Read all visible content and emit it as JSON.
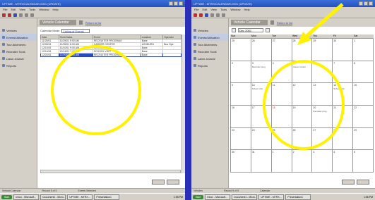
{
  "panels": [
    {
      "window_title": "UPTIME - MTRX/CALENDAR-0001 (UPDATE)",
      "menu": [
        "File",
        "Edit",
        "View",
        "Tools",
        "Window",
        "Help"
      ],
      "sidebar": [
        {
          "label": "Vehicles",
          "selected": false
        },
        {
          "label": "Events/Utilization",
          "selected": true
        },
        {
          "label": "Tour Allotments",
          "selected": false
        },
        {
          "label": "Recruiter Tools",
          "selected": false
        },
        {
          "label": "Labor Journal",
          "selected": false
        },
        {
          "label": "Reports",
          "selected": false
        }
      ],
      "page_title": "Vehicle Calendar",
      "header_link": "Return to list",
      "filter_label": "Calendar Mode",
      "filter_value": "Listing of Events",
      "table": {
        "columns": [
          "Date",
          "Time/Dates",
          "Event",
          "Location",
          "Operator"
        ],
        "rows": [
          [
            "11/29/01",
            "11/29/01 9:00 AM",
            "RECRUITER PROGRAM",
            "Base",
            ""
          ],
          [
            "12/05/01",
            "12/05/01 8:00 AM",
            "CAREER CENTER",
            "ASHBURN",
            "Bus Ops"
          ],
          [
            "12/10/01",
            "12/10/01 9:00 AM",
            "SCHOOL VISIT",
            "Base",
            ""
          ],
          [
            "12/14/01",
            "12/14/01 7:00 AM",
            "SCHOOL VISIT",
            "Base",
            ""
          ],
          [
            "12/20/01",
            "12/20/01 8:00 AM",
            "RECRUITER PROGRAM",
            "Base",
            ""
          ]
        ],
        "selected_row": 4
      },
      "status": [
        "Vehicle/Calendar",
        "Record 5 of 5",
        "Events Selected"
      ],
      "taskbar": [
        "Start",
        "Inbox - Microsoft...",
        "Document1 - Micro...",
        "UPTIME - MTRX...",
        "Presentation1"
      ],
      "clock": "1:55 PM"
    },
    {
      "window_title": "UPTIME - MTRX/CALENDAR-0001 (UPDATE)",
      "menu": [
        "File",
        "Edit",
        "View",
        "Tools",
        "Window",
        "Help"
      ],
      "sidebar": [
        {
          "label": "Vehicles",
          "selected": false
        },
        {
          "label": "Events/Utilization",
          "selected": true
        },
        {
          "label": "Tour Allotments",
          "selected": false
        },
        {
          "label": "Recruiter Tools",
          "selected": false
        },
        {
          "label": "Labor Journal",
          "selected": false
        },
        {
          "label": "Reports",
          "selected": false
        }
      ],
      "page_title": "Vehicle Calendar",
      "header_link": "Return to list",
      "month": "Dec 2001",
      "weekdays": [
        "Sun",
        "Mon",
        "Tue",
        "Wed",
        "Thu",
        "Fri",
        "Sat"
      ],
      "days": [
        {
          "n": "25",
          "ev": ""
        },
        {
          "n": "26",
          "ev": ""
        },
        {
          "n": "27",
          "ev": ""
        },
        {
          "n": "28",
          "ev": ""
        },
        {
          "n": "29",
          "ev": ""
        },
        {
          "n": "30",
          "ev": ""
        },
        {
          "n": "1",
          "ev": ""
        },
        {
          "n": "2",
          "ev": ""
        },
        {
          "n": "3",
          "ev": "Recruiter prog"
        },
        {
          "n": "4",
          "ev": ""
        },
        {
          "n": "5",
          "ev": "Career center"
        },
        {
          "n": "6",
          "ev": ""
        },
        {
          "n": "7",
          "ev": ""
        },
        {
          "n": "8",
          "ev": ""
        },
        {
          "n": "9",
          "ev": ""
        },
        {
          "n": "10",
          "ev": "School visit"
        },
        {
          "n": "11",
          "ev": ""
        },
        {
          "n": "12",
          "ev": ""
        },
        {
          "n": "13",
          "ev": ""
        },
        {
          "n": "14",
          "ev": "School visit"
        },
        {
          "n": "15",
          "ev": ""
        },
        {
          "n": "16",
          "ev": ""
        },
        {
          "n": "17",
          "ev": ""
        },
        {
          "n": "18",
          "ev": "",
          "red": true
        },
        {
          "n": "19",
          "ev": ""
        },
        {
          "n": "20",
          "ev": "Recruiter prog"
        },
        {
          "n": "21",
          "ev": ""
        },
        {
          "n": "22",
          "ev": ""
        },
        {
          "n": "23",
          "ev": ""
        },
        {
          "n": "24",
          "ev": ""
        },
        {
          "n": "25",
          "ev": ""
        },
        {
          "n": "26",
          "ev": ""
        },
        {
          "n": "27",
          "ev": ""
        },
        {
          "n": "28",
          "ev": ""
        },
        {
          "n": "29",
          "ev": ""
        },
        {
          "n": "30",
          "ev": ""
        },
        {
          "n": "31",
          "ev": ""
        },
        {
          "n": "1",
          "ev": ""
        },
        {
          "n": "2",
          "ev": ""
        },
        {
          "n": "3",
          "ev": ""
        },
        {
          "n": "4",
          "ev": ""
        },
        {
          "n": "5",
          "ev": ""
        }
      ],
      "status": [
        "Vehicles",
        "Record 5 of 5",
        "Calendar"
      ],
      "taskbar": [
        "Start",
        "Inbox - Microsoft...",
        "Document1 - Micro...",
        "UPTIME - MTRX...",
        "Presentation1"
      ],
      "clock": "1:56 PM"
    }
  ],
  "annotation": {
    "highlight_color": "#fff200",
    "arrow_target": "calendar-month-selector"
  },
  "colors": {
    "background": "#2a2fb8",
    "window": "#d4d0c8",
    "titlebar": "#2452c0",
    "selected_row": "#2a4bbf"
  }
}
